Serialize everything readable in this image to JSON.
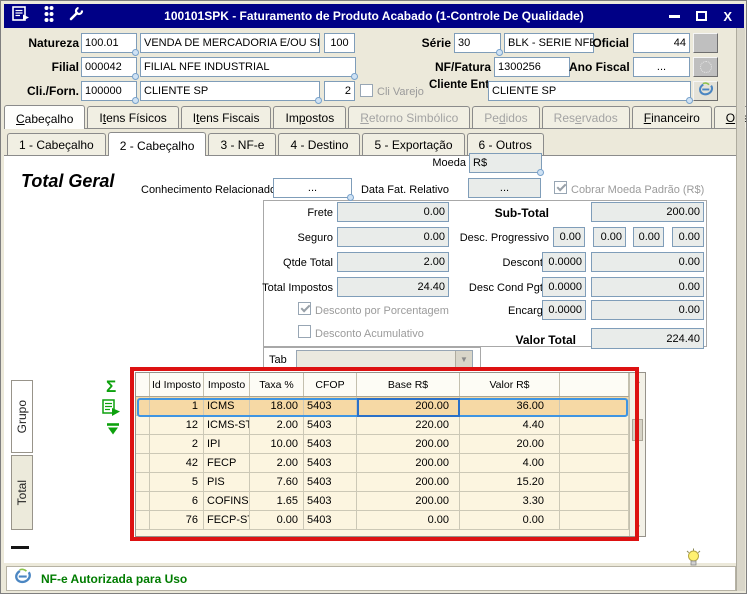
{
  "window": {
    "title": "100101SPK - Faturamento de Produto Acabado (1-Controle De Qualidade)"
  },
  "glyphs": {
    "sigma": "Σ",
    "close": "X",
    "combo_arrow": "▼",
    "scroll_up": "▲",
    "scroll_down": "▼"
  },
  "colors": {
    "titlebar": "#000086",
    "annotation_red": "#dd1111",
    "status_green": "#007c00",
    "grid_row_bg": "#fcf5e0",
    "grid_selected_bg": "#f6d9a5",
    "field_border": "#7f9db9",
    "icon_green": "#0da10d"
  },
  "form": {
    "natureza_label": "Natureza",
    "natureza_code": "100.01",
    "natureza_desc": "VENDA DE MERCADORIA E/OU SERVI",
    "natureza_extra": "100",
    "filial_label": "Filial",
    "filial_code": "000042",
    "filial_desc": "FILIAL NFE INDUSTRIAL",
    "cliforn_label": "Cli./Forn.",
    "cliforn_code": "100000",
    "cliforn_desc": "CLIENTE SP",
    "cliforn_extra": "2",
    "clivarejo_label": "Cli Varejo",
    "serie_label": "Série",
    "serie_code": "30",
    "serie_desc": "BLK - SERIE NFE",
    "oficial_label": "Oficial",
    "oficial_value": "44",
    "nffatura_label": "NF/Fatura",
    "nffatura_value": "1300256",
    "anofiscal_label": "Ano Fiscal",
    "anofiscal_value": "...",
    "clienteentrega_label": "Cliente Entrega",
    "clienteentrega_value": "CLIENTE SP"
  },
  "tabs_main": [
    {
      "id": "cabecalho",
      "label": "Cabeçalho",
      "accel": 0,
      "active": true,
      "disabled": false
    },
    {
      "id": "itens-fisicos",
      "label": "Itens Físicos",
      "accel": 1,
      "active": false,
      "disabled": false
    },
    {
      "id": "itens-fiscais",
      "label": "Itens Fiscais",
      "accel": 1,
      "active": false,
      "disabled": false
    },
    {
      "id": "impostos",
      "label": "Impostos",
      "accel": 2,
      "active": false,
      "disabled": false
    },
    {
      "id": "retorno-simbolico",
      "label": "Retorno Simbólico",
      "accel": 0,
      "active": false,
      "disabled": true
    },
    {
      "id": "pedidos",
      "label": "Pedidos",
      "accel": 2,
      "active": false,
      "disabled": true
    },
    {
      "id": "reservados",
      "label": "Reservados",
      "accel": 3,
      "active": false,
      "disabled": true
    },
    {
      "id": "financeiro",
      "label": "Financeiro",
      "accel": 0,
      "active": false,
      "disabled": false
    },
    {
      "id": "observacoes",
      "label": "Observações",
      "accel": 0,
      "active": false,
      "disabled": false
    }
  ],
  "tabs_sub": [
    {
      "id": "1-cabecalho",
      "label": "1 - Cabeçalho",
      "active": false
    },
    {
      "id": "2-cabecalho",
      "label": "2 - Cabeçalho",
      "active": true
    },
    {
      "id": "3-nfe",
      "label": "3 - NF-e",
      "active": false
    },
    {
      "id": "4-destino",
      "label": "4 - Destino",
      "active": false
    },
    {
      "id": "5-exportacao",
      "label": "5 - Exportação",
      "active": false
    },
    {
      "id": "6-outros",
      "label": "6 - Outros",
      "active": false
    }
  ],
  "content": {
    "moeda_label": "Moeda",
    "moeda_value": "R$",
    "total_geral": "Total Geral",
    "conhecimento_label": "Conhecimento Relacionado",
    "conhecimento_value": "...",
    "datafat_label": "Data Fat. Relativo",
    "datafat_value": "...",
    "cobrar_moeda_label": "Cobrar Moeda Padrão (R$)",
    "cobrar_moeda_checked": true
  },
  "totais": {
    "frete_label": "Frete",
    "frete": "0.00",
    "seguro_label": "Seguro",
    "seguro": "0.00",
    "qtde_label": "Qtde Total",
    "qtde": "2.00",
    "impostos_label": "Total Impostos",
    "impostos": "24.40",
    "subtotal_label": "Sub-Total",
    "subtotal": "200.00",
    "descprog_label": "Desc. Progressivo",
    "descprog": [
      "0.00",
      "0.00",
      "0.00",
      "0.00"
    ],
    "desconto_label": "Desconto",
    "desconto_pct": "0.0000",
    "desconto_val": "0.00",
    "desccond_label": "Desc Cond Pgto",
    "desccond_pct": "0.0000",
    "desccond_val": "0.00",
    "encargo_label": "Encargo",
    "encargo_pct": "0.0000",
    "encargo_val": "0.00",
    "valortotal_label": "Valor Total",
    "valortotal": "224.40",
    "chk_porcentagem_label": "Desconto por Porcentagem",
    "chk_porcentagem_checked": true,
    "chk_acumulativo_label": "Desconto Acumulativo",
    "chk_acumulativo_checked": false,
    "tab_label": "Tab",
    "tab_value": ""
  },
  "side_tabs": [
    {
      "id": "grupo",
      "label": "Grupo",
      "active": true
    },
    {
      "id": "total",
      "label": "Total",
      "active": false
    }
  ],
  "grid": {
    "columns": [
      "Id Imposto",
      "Imposto",
      "Taxa %",
      "CFOP",
      "Base R$",
      "Valor R$",
      ""
    ],
    "rows": [
      [
        "1",
        "ICMS",
        "18.00",
        "5403",
        "200.00",
        "36.00"
      ],
      [
        "12",
        "ICMS-ST",
        "2.00",
        "5403",
        "220.00",
        "4.40"
      ],
      [
        "2",
        "IPI",
        "10.00",
        "5403",
        "200.00",
        "20.00"
      ],
      [
        "42",
        "FECP",
        "2.00",
        "5403",
        "200.00",
        "4.00"
      ],
      [
        "5",
        "PIS",
        "7.60",
        "5403",
        "200.00",
        "15.20"
      ],
      [
        "6",
        "COFINS",
        "1.65",
        "5403",
        "200.00",
        "3.30"
      ],
      [
        "76",
        "FECP-ST",
        "0.00",
        "5403",
        "0.00",
        "0.00"
      ]
    ],
    "selected_row": 0
  },
  "statusbar": {
    "text": "NF-e Autorizada para Uso"
  }
}
